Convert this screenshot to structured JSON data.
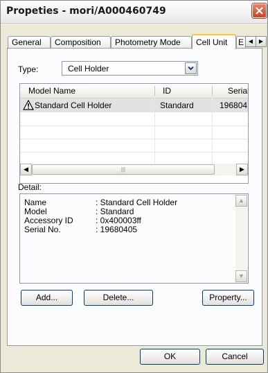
{
  "window": {
    "title": "Propeties - mori/A000460749"
  },
  "tabs": [
    {
      "label": "General",
      "active": false
    },
    {
      "label": "Composition",
      "active": false
    },
    {
      "label": "Photometry Mode",
      "active": false
    },
    {
      "label": "Cell Unit",
      "active": true
    },
    {
      "label": "E",
      "active": false
    }
  ],
  "type_field": {
    "label": "Type:",
    "value": "Cell Holder"
  },
  "list": {
    "columns": [
      "Model Name",
      "ID",
      "Serial N"
    ],
    "rows": [
      {
        "model_name": "Standard Cell Holder",
        "id": "Standard",
        "serial": "196804",
        "selected": true,
        "icon": "warning-icon"
      }
    ]
  },
  "detail": {
    "label": "Detail:",
    "lines": [
      {
        "key": "Name",
        "value": ": Standard Cell Holder"
      },
      {
        "key": "Model",
        "value": ": Standard"
      },
      {
        "key": "Accessory ID",
        "value": ": 0x400003ff"
      },
      {
        "key": "Serial No.",
        "value": ": 19680405"
      }
    ]
  },
  "buttons": {
    "add": "Add...",
    "delete": "Delete...",
    "property": "Property...",
    "ok": "OK",
    "cancel": "Cancel"
  },
  "colors": {
    "face": "#ece9d8",
    "close_red": "#c8452a",
    "active_tab_accent": "#ffc73c",
    "selection_gray": "#e2e2e2"
  }
}
